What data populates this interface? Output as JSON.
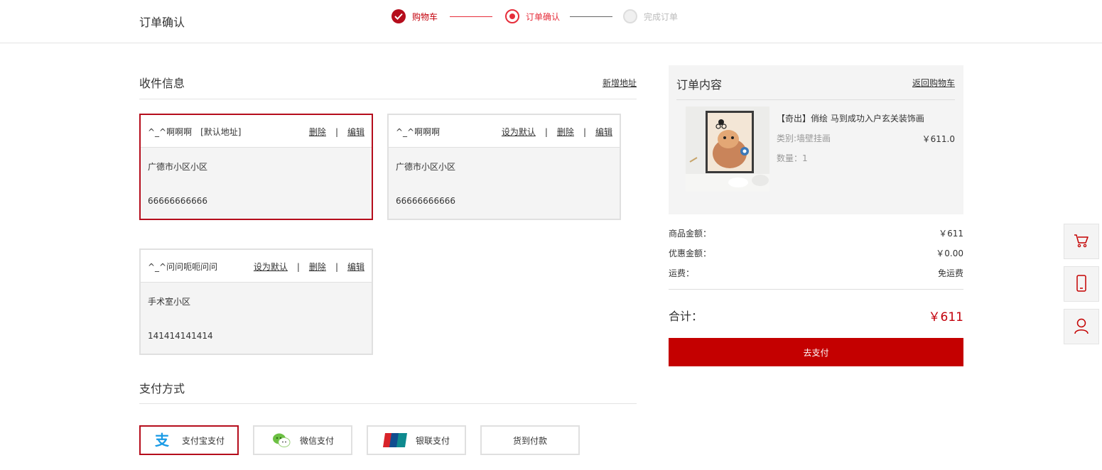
{
  "header": {
    "title": "订单确认",
    "steps": [
      {
        "label": "购物车",
        "state": "done"
      },
      {
        "label": "订单确认",
        "state": "current"
      },
      {
        "label": "完成订单",
        "state": "pending"
      }
    ]
  },
  "address": {
    "title": "收件信息",
    "add_label": "新增地址",
    "cards": [
      {
        "name": "^_^啊啊啊",
        "tag": "[默认地址]",
        "ops": [
          "删除",
          "编辑"
        ],
        "address": "广德市小区小区",
        "phone": "66666666666"
      },
      {
        "name": "^_^啊啊啊",
        "tag": "",
        "ops": [
          "设为默认",
          "删除",
          "编辑"
        ],
        "address": "广德市小区小区",
        "phone": "66666666666"
      },
      {
        "name": "^_^问问呃呃问问",
        "tag": "",
        "ops": [
          "设为默认",
          "删除",
          "编辑"
        ],
        "address": "手术室小区",
        "phone": "141414141414"
      }
    ]
  },
  "payment": {
    "title": "支付方式",
    "options": [
      {
        "label": "支付宝支付",
        "icon": "alipay-icon"
      },
      {
        "label": "微信支付",
        "icon": "wechat-icon"
      },
      {
        "label": "银联支付",
        "icon": "unionpay-icon"
      },
      {
        "label": "货到付款",
        "icon": ""
      }
    ],
    "selected": "支付宝支付"
  },
  "order": {
    "title": "订单内容",
    "back_label": "返回购物车",
    "product": {
      "name": "【奇出】俏绘 马到成功入户玄关装饰画",
      "category": "类别:墙壁挂画",
      "price": "￥611.0",
      "quantity": "数量：1"
    },
    "summary": {
      "goods_label": "商品金额：",
      "goods_value": "￥611",
      "discount_label": "优惠金额：",
      "discount_value": "￥0.00",
      "shipping_label": "运费：",
      "shipping_value": "免运费"
    },
    "total_label": "合计：",
    "total_value": "￥611",
    "pay_button": "去支付"
  },
  "side_toolbar": [
    "cart-icon",
    "phone-icon",
    "user-icon"
  ],
  "colors": {
    "accent": "#c40000",
    "step_active": "#e62d3a"
  }
}
